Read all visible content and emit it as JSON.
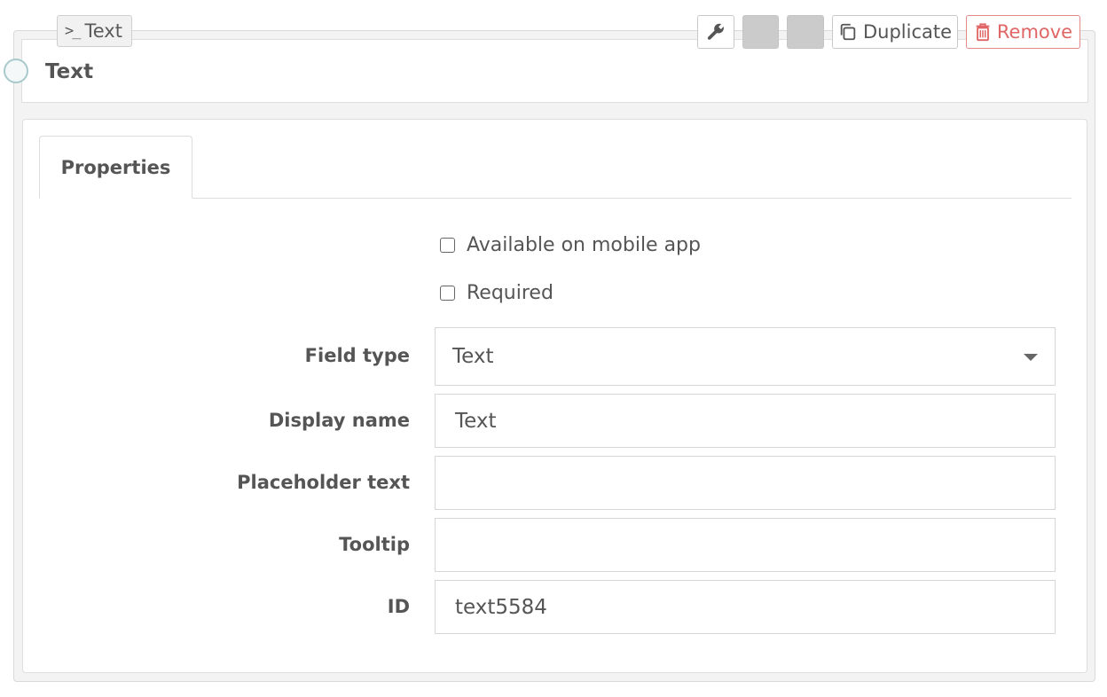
{
  "component": {
    "type_badge_icon": "terminal-prompt-icon",
    "type_badge_prompt": ">_",
    "type_badge_label": "Text",
    "title": "Text"
  },
  "toolbar": {
    "settings_icon": "wrench-icon",
    "duplicate_label": "Duplicate",
    "remove_label": "Remove",
    "remove_color": "#e06666"
  },
  "tabs": [
    {
      "label": "Properties",
      "active": true
    }
  ],
  "checkboxes": {
    "mobile_label": "Available on mobile app",
    "mobile_checked": false,
    "required_label": "Required",
    "required_checked": false
  },
  "fields": {
    "field_type": {
      "label": "Field type",
      "value": "Text"
    },
    "display_name": {
      "label": "Display name",
      "value": "Text"
    },
    "placeholder_text": {
      "label": "Placeholder text",
      "value": ""
    },
    "tooltip": {
      "label": "Tooltip",
      "value": ""
    },
    "id": {
      "label": "ID",
      "value": "text5584"
    }
  }
}
